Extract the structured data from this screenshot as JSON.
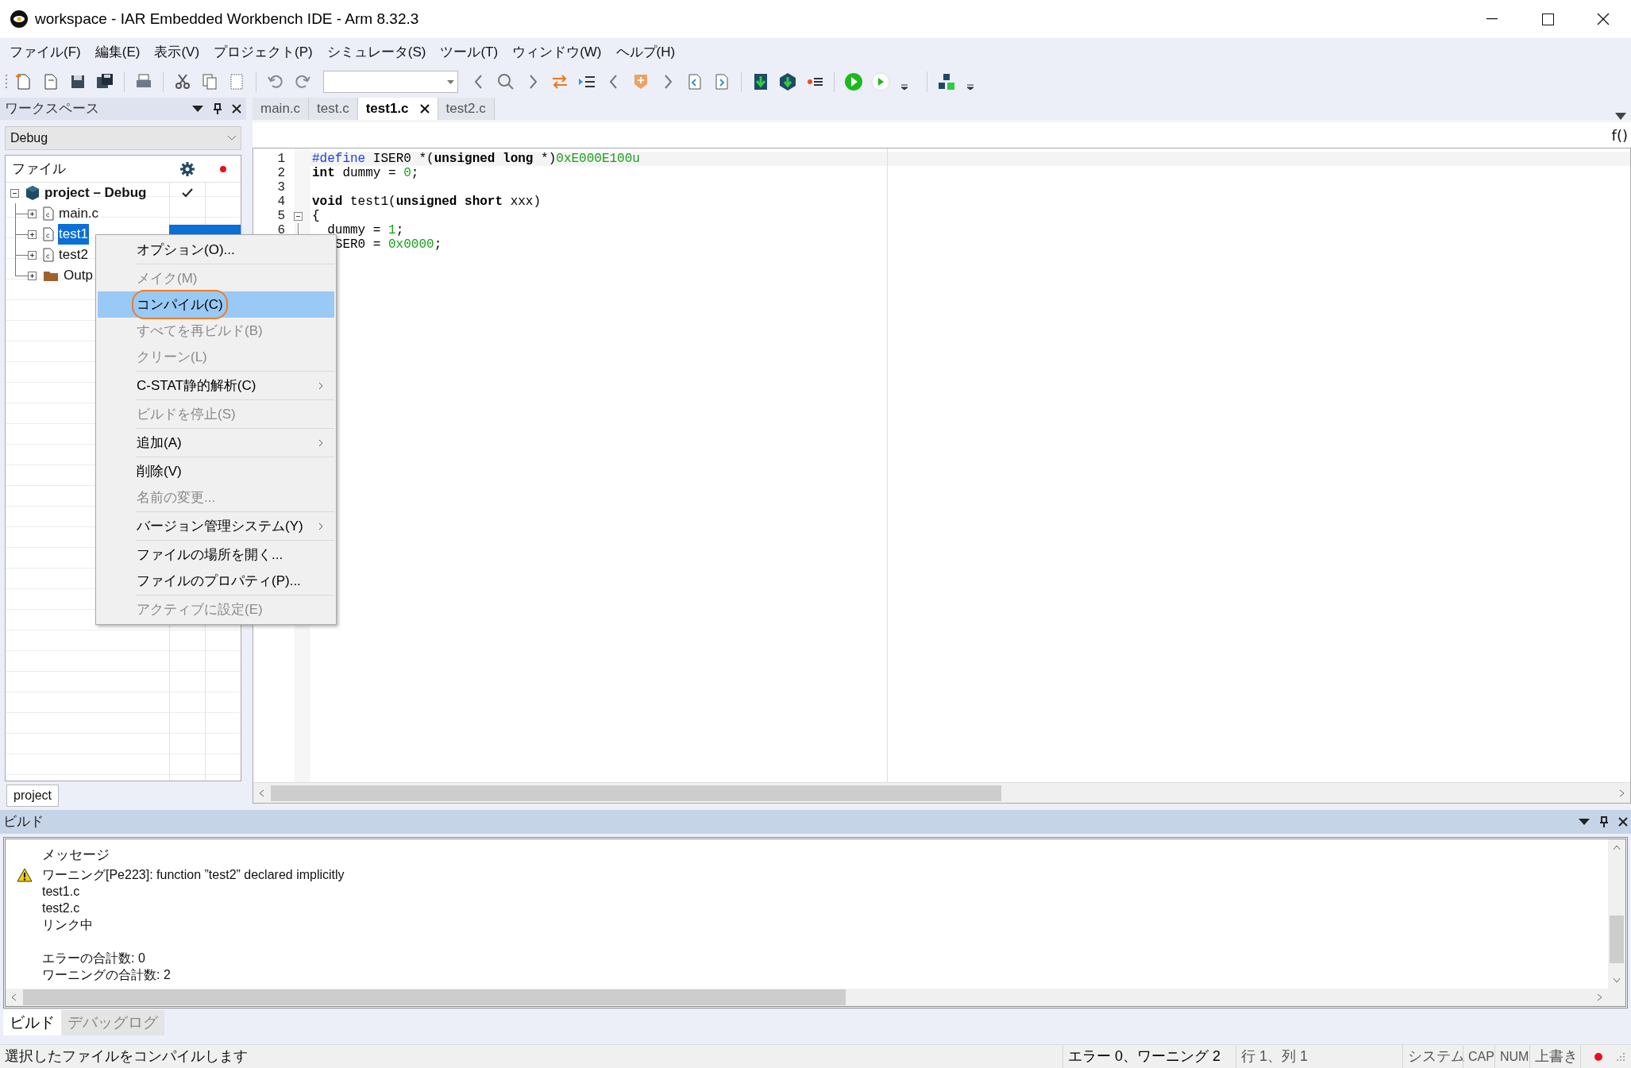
{
  "window": {
    "title": "workspace - IAR Embedded Workbench IDE - Arm 8.32.3"
  },
  "menu_bar": [
    "ファイル(F)",
    "編集(E)",
    "表示(V)",
    "プロジェクト(P)",
    "シミュレータ(S)",
    "ツール(T)",
    "ウィンドウ(W)",
    "ヘルプ(H)"
  ],
  "workspace": {
    "title": "ワークスペース",
    "configuration": "Debug",
    "column_header": "ファイル",
    "tree": [
      {
        "label": "project – Debug",
        "kind": "project",
        "expanded": true,
        "built": true,
        "selected": false,
        "children": [
          {
            "label": "main.c",
            "kind": "file",
            "expanded": false,
            "built": false,
            "selected": false
          },
          {
            "label": "test1",
            "kind": "file",
            "expanded": false,
            "built": false,
            "selected": true
          },
          {
            "label": "test2",
            "kind": "file",
            "expanded": false,
            "built": false,
            "selected": false
          },
          {
            "label": "Outp",
            "kind": "folder",
            "expanded": false,
            "built": false,
            "selected": false
          }
        ]
      }
    ],
    "tabs": [
      {
        "label": "project",
        "selected": true
      }
    ]
  },
  "editor": {
    "tabs": [
      {
        "label": "main.c",
        "selected": false
      },
      {
        "label": "test.c",
        "selected": false
      },
      {
        "label": "test1.c",
        "selected": true
      },
      {
        "label": "test2.c",
        "selected": false
      }
    ],
    "function_button": "f()",
    "lines": [
      {
        "number": "1",
        "fold": false,
        "tokens": [
          {
            "text": "#define",
            "kind": "preprocessor"
          },
          {
            "text": " ISER0 *(",
            "kind": "plain"
          },
          {
            "text": "unsigned long",
            "kind": "keyword"
          },
          {
            "text": " *)",
            "kind": "plain"
          },
          {
            "text": "0xE000E100u",
            "kind": "number"
          }
        ]
      },
      {
        "number": "2",
        "fold": false,
        "tokens": [
          {
            "text": "int",
            "kind": "keyword"
          },
          {
            "text": " dummy = ",
            "kind": "plain"
          },
          {
            "text": "0",
            "kind": "number"
          },
          {
            "text": ";",
            "kind": "plain"
          }
        ]
      },
      {
        "number": "3",
        "fold": false
      },
      {
        "number": "4",
        "fold": false,
        "tokens": [
          {
            "text": "void",
            "kind": "keyword"
          },
          {
            "text": " test1(",
            "kind": "plain"
          },
          {
            "text": "unsigned short",
            "kind": "keyword"
          },
          {
            "text": " xxx)",
            "kind": "plain"
          }
        ]
      },
      {
        "number": "5",
        "fold": true,
        "tokens": [
          {
            "text": "{",
            "kind": "plain"
          }
        ]
      },
      {
        "number": "6",
        "fold": false,
        "tokens": [
          {
            "text": "  dummy = ",
            "kind": "plain"
          },
          {
            "text": "1",
            "kind": "number"
          },
          {
            "text": ";",
            "kind": "plain"
          }
        ]
      },
      {
        "fold": false,
        "tokens": [
          {
            "text": "   SER0 = ",
            "kind": "plain"
          },
          {
            "text": "0x0000",
            "kind": "number"
          },
          {
            "text": ";",
            "kind": "plain"
          }
        ]
      }
    ]
  },
  "context_menu": {
    "items": [
      {
        "label": "オプション(O)...",
        "disabled": false,
        "highlighted": false,
        "circled": false,
        "submenu": false,
        "separator_after": true
      },
      {
        "label": "メイク(M)",
        "disabled": true,
        "highlighted": false,
        "circled": false,
        "submenu": false,
        "separator_after": false
      },
      {
        "label": "コンパイル(C)",
        "disabled": false,
        "highlighted": true,
        "circled": true,
        "submenu": false,
        "separator_after": false
      },
      {
        "label": "すべてを再ビルド(B)",
        "disabled": true,
        "highlighted": false,
        "circled": false,
        "submenu": false,
        "separator_after": false
      },
      {
        "label": "クリーン(L)",
        "disabled": true,
        "highlighted": false,
        "circled": false,
        "submenu": false,
        "separator_after": true
      },
      {
        "label": "C-STAT静的解析(C)",
        "disabled": false,
        "highlighted": false,
        "circled": false,
        "submenu": true,
        "separator_after": true
      },
      {
        "label": "ビルドを停止(S)",
        "disabled": true,
        "highlighted": false,
        "circled": false,
        "submenu": false,
        "separator_after": true
      },
      {
        "label": "追加(A)",
        "disabled": false,
        "highlighted": false,
        "circled": false,
        "submenu": true,
        "separator_after": true
      },
      {
        "label": "削除(V)",
        "disabled": false,
        "highlighted": false,
        "circled": false,
        "submenu": false,
        "separator_after": false
      },
      {
        "label": "名前の変更...",
        "disabled": true,
        "highlighted": false,
        "circled": false,
        "submenu": false,
        "separator_after": true
      },
      {
        "label": "バージョン管理システム(Y)",
        "disabled": false,
        "highlighted": false,
        "circled": false,
        "submenu": true,
        "separator_after": true
      },
      {
        "label": "ファイルの場所を開く...",
        "disabled": false,
        "highlighted": false,
        "circled": false,
        "submenu": false,
        "separator_after": false
      },
      {
        "label": "ファイルのプロパティ(P)...",
        "disabled": false,
        "highlighted": false,
        "circled": false,
        "submenu": false,
        "separator_after": true
      },
      {
        "label": "アクティブに設定(E)",
        "disabled": true,
        "highlighted": false,
        "circled": false,
        "submenu": false,
        "separator_after": false
      }
    ]
  },
  "build_pane": {
    "title": "ビルド",
    "column_header": "メッセージ",
    "messages": [
      {
        "kind": "warning",
        "text": "ワーニング[Pe223]: function ”test2” declared implicitly"
      },
      {
        "kind": "plain",
        "text": "test1.c"
      },
      {
        "kind": "plain",
        "text": "test2.c"
      },
      {
        "kind": "plain",
        "text": "リンク中"
      },
      {
        "kind": "blank"
      },
      {
        "kind": "plain",
        "text": "エラーの合計数: 0"
      },
      {
        "kind": "plain",
        "text": "ワーニングの合計数: 2"
      }
    ],
    "tabs": [
      {
        "label": "ビルド",
        "selected": true
      },
      {
        "label": "デバッグログ",
        "selected": false
      }
    ]
  },
  "status_bar": {
    "message": "選択したファイルをコンパイルします",
    "fields": [
      "エラー 0、ワーニング 2",
      "行 1、列 1",
      "システム",
      "CAP",
      "NUM",
      "上書き"
    ]
  }
}
